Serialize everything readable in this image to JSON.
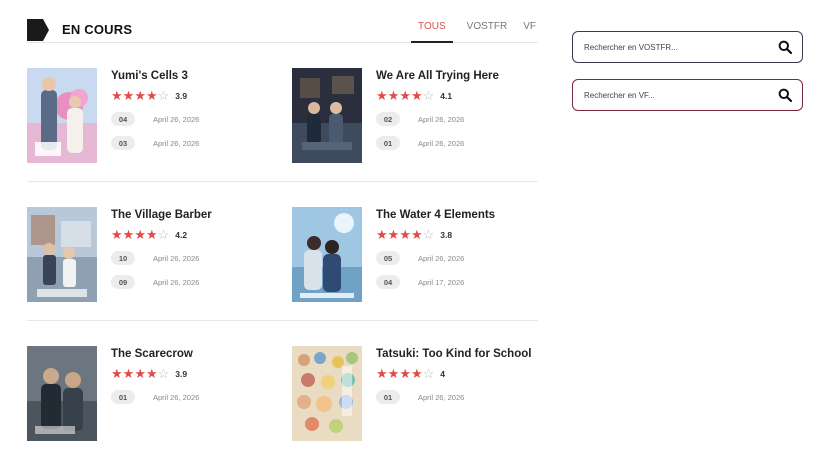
{
  "header": {
    "title": "EN COURS",
    "tabs": [
      {
        "label": "TOUS",
        "active": true
      },
      {
        "label": "VOSTFR",
        "active": false
      },
      {
        "label": "VF",
        "active": false
      }
    ]
  },
  "colors": {
    "accent": "#d9534f",
    "star": "#e04b48"
  },
  "cards": [
    {
      "title": "Yumi's Cells 3",
      "rating": "3.9",
      "stars": 4,
      "episodes": [
        {
          "num": "04",
          "date": "April 26, 2026"
        },
        {
          "num": "03",
          "date": "April 26, 2026"
        }
      ]
    },
    {
      "title": "We Are All Trying Here",
      "rating": "4.1",
      "stars": 4,
      "episodes": [
        {
          "num": "02",
          "date": "April 26, 2026"
        },
        {
          "num": "01",
          "date": "April 26, 2026"
        }
      ]
    },
    {
      "title": "The Village Barber",
      "rating": "4.2",
      "stars": 4,
      "episodes": [
        {
          "num": "10",
          "date": "April 26, 2026"
        },
        {
          "num": "09",
          "date": "April 26, 2026"
        }
      ]
    },
    {
      "title": "The Water 4 Elements",
      "rating": "3.8",
      "stars": 4,
      "episodes": [
        {
          "num": "05",
          "date": "April 26, 2026"
        },
        {
          "num": "04",
          "date": "April 17, 2026"
        }
      ]
    },
    {
      "title": "The Scarecrow",
      "rating": "3.9",
      "stars": 4,
      "episodes": [
        {
          "num": "01",
          "date": "April 26, 2026"
        }
      ]
    },
    {
      "title": "Tatsuki: Too Kind for School",
      "rating": "4",
      "stars": 4,
      "episodes": [
        {
          "num": "01",
          "date": "April 26, 2026"
        }
      ]
    }
  ],
  "search": {
    "vostfr_placeholder": "Rechercher en VOSTFR...",
    "vf_placeholder": "Rechercher en VF..."
  }
}
